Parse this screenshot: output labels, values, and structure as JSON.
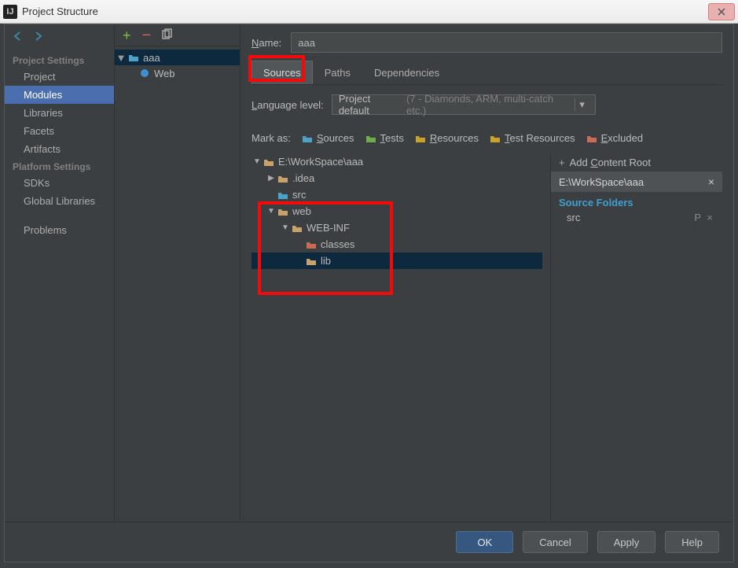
{
  "window": {
    "title": "Project Structure"
  },
  "nav": {
    "back_disabled": false,
    "heading1": "Project Settings",
    "items1": [
      "Project",
      "Modules",
      "Libraries",
      "Facets",
      "Artifacts"
    ],
    "selected1": "Modules",
    "heading2": "Platform Settings",
    "items2": [
      "SDKs",
      "Global Libraries"
    ],
    "problems": "Problems"
  },
  "modules": {
    "root": {
      "name": "aaa",
      "expanded": true
    },
    "children": [
      {
        "name": "Web",
        "icon": "globe"
      }
    ]
  },
  "editor": {
    "name_label": "Name:",
    "name_value": "aaa",
    "tabs": [
      "Sources",
      "Paths",
      "Dependencies"
    ],
    "active_tab": "Sources",
    "lang_label": "Language level:",
    "lang_value_prefix": "Project default ",
    "lang_value_dim": "(7 - Diamonds, ARM, multi-catch etc.)",
    "mark_as_label": "Mark as:",
    "mark_as": [
      {
        "label": "Sources",
        "color": "#4ea2c8"
      },
      {
        "label": "Tests",
        "color": "#6fae4a"
      },
      {
        "label": "Resources",
        "color": "#c9a229"
      },
      {
        "label": "Test Resources",
        "color": "#c9a229"
      },
      {
        "label": "Excluded",
        "color": "#cc6b55"
      }
    ],
    "src_tree": {
      "root": "E:\\WorkSpace\\aaa",
      "nodes": [
        {
          "depth": 0,
          "arrow": "▼",
          "label": "E:\\WorkSpace\\aaa",
          "color": "#c9a26b"
        },
        {
          "depth": 1,
          "arrow": "▶",
          "label": ".idea",
          "color": "#c9a26b"
        },
        {
          "depth": 1,
          "arrow": "",
          "label": "src",
          "color": "#4ea2c8"
        },
        {
          "depth": 1,
          "arrow": "▼",
          "label": "web",
          "color": "#c9a26b"
        },
        {
          "depth": 2,
          "arrow": "▼",
          "label": "WEB-INF",
          "color": "#c9a26b"
        },
        {
          "depth": 3,
          "arrow": "",
          "label": "classes",
          "color": "#cc6b55"
        },
        {
          "depth": 3,
          "arrow": "",
          "label": "lib",
          "color": "#c9a26b",
          "selected": true
        }
      ]
    },
    "content_root": {
      "add_label": "Add Content Root",
      "path": "E:\\WorkSpace\\aaa",
      "source_folders_label": "Source Folders",
      "source_folders": [
        "src"
      ]
    }
  },
  "buttons": {
    "ok": "OK",
    "cancel": "Cancel",
    "apply": "Apply",
    "help": "Help"
  }
}
